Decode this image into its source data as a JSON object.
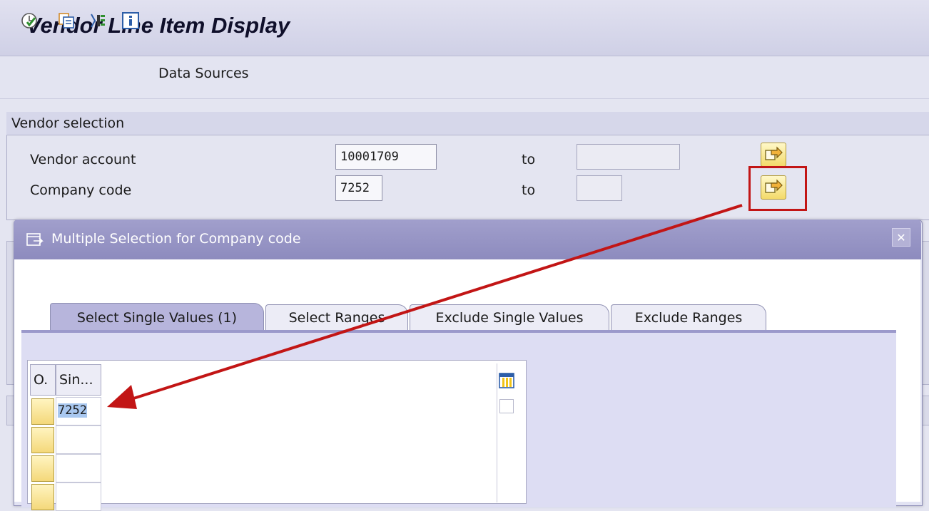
{
  "title": "Vendor Line Item Display",
  "toolbar": {
    "execute_icon": "execute-icon",
    "copy_icon": "get-variant-icon",
    "selection_icon": "dynamic-selection-icon",
    "info_icon": "info-icon",
    "data_sources_label": "Data Sources"
  },
  "vendor_selection": {
    "group_title": "Vendor selection",
    "rows": [
      {
        "label": "Vendor account",
        "from": "10001709",
        "to_label": "to",
        "to": ""
      },
      {
        "label": "Company code",
        "from": "7252",
        "to_label": "to",
        "to": ""
      }
    ]
  },
  "dialog": {
    "title": "Multiple Selection for Company code",
    "close_icon": "close-icon",
    "tabs": [
      {
        "label": "Select Single Values (1)",
        "active": true
      },
      {
        "label": "Select Ranges",
        "active": false
      },
      {
        "label": "Exclude Single Values",
        "active": false
      },
      {
        "label": "Exclude Ranges",
        "active": false
      }
    ],
    "table": {
      "columns": [
        "O.",
        "Sin..."
      ],
      "rows": [
        "7252",
        "",
        "",
        ""
      ]
    }
  },
  "colors": {
    "annotation_arrow": "#c21515",
    "dialog_title_bg": "#9896c7",
    "selection_button": "#f3da6a"
  }
}
